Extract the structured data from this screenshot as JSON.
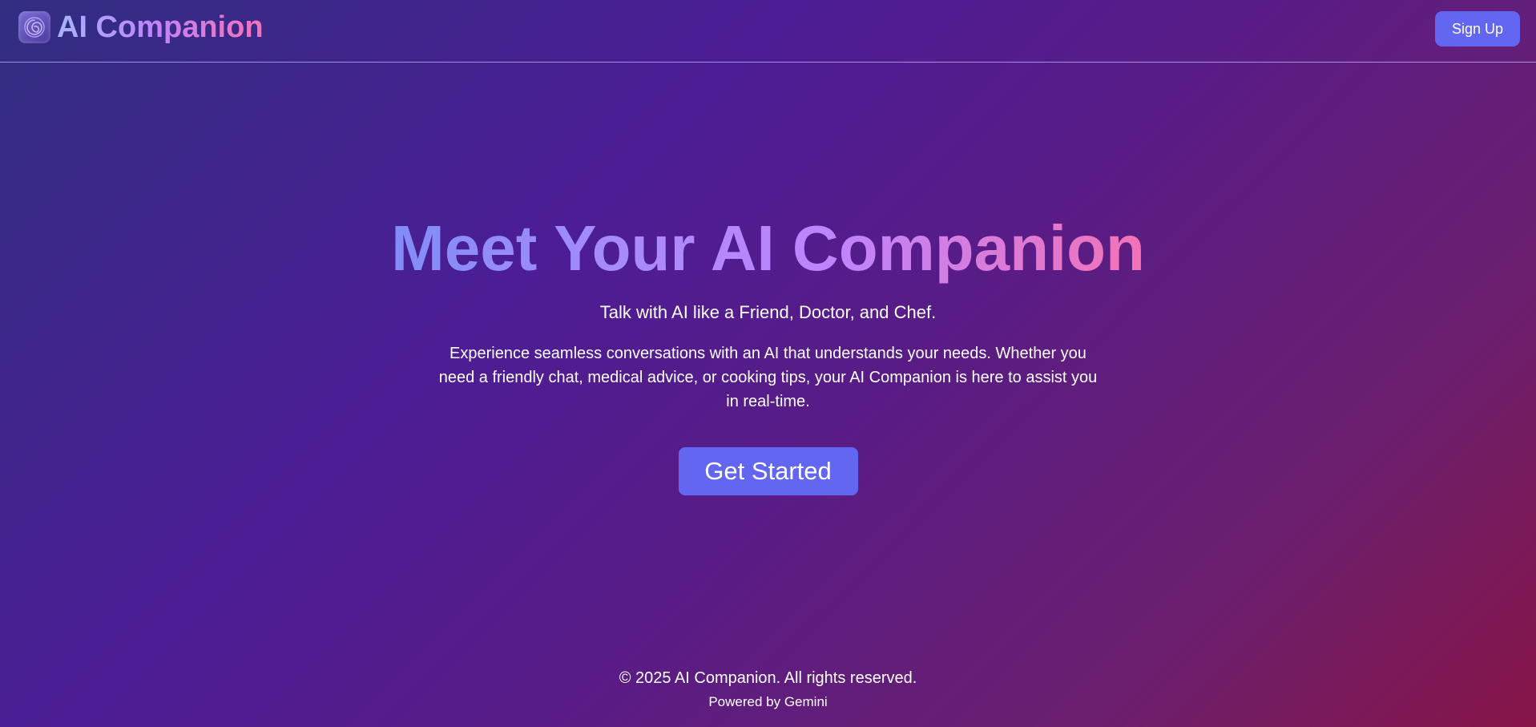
{
  "header": {
    "brand_name": "AI Companion",
    "logo_icon": "spiral-logo-icon",
    "signup_label": "Sign Up"
  },
  "hero": {
    "title": "Meet Your AI Companion",
    "subtitle": "Talk with AI like a Friend, Doctor, and Chef.",
    "description": "Experience seamless conversations with an AI that understands your needs. Whether you need a friendly chat, medical advice, or cooking tips, your AI Companion is here to assist you in real-time.",
    "cta_label": "Get Started"
  },
  "footer": {
    "copyright": "© 2025 AI Companion. All rights reserved.",
    "powered_by": "Powered by Gemini"
  },
  "colors": {
    "accent": "#6366f1",
    "gradient_start": "#818cf8",
    "gradient_mid": "#c084fc",
    "gradient_end": "#f472b6",
    "background_start": "#312e81",
    "background_end": "#861547"
  }
}
